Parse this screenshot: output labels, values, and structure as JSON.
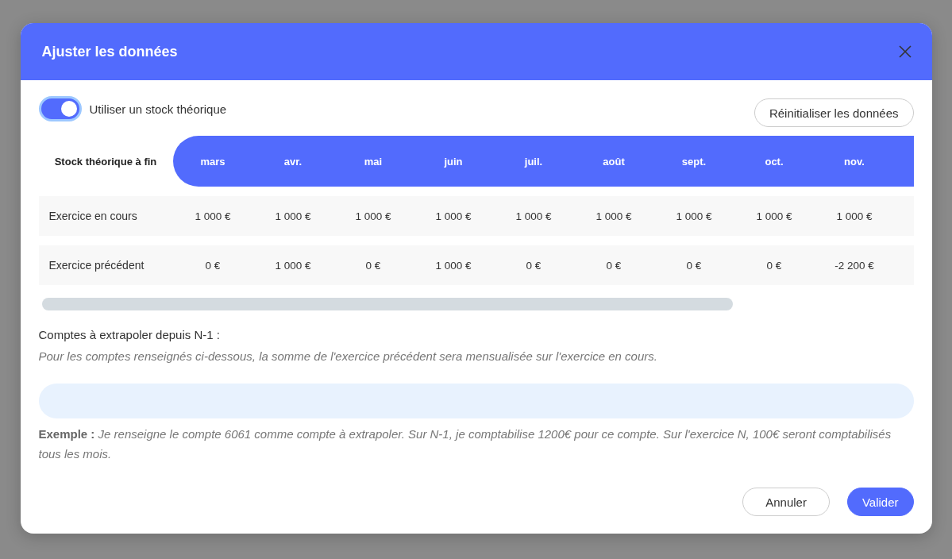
{
  "dialog": {
    "title": "Ajuster les données"
  },
  "toggle": {
    "label": "Utiliser un stock théorique",
    "on": true
  },
  "reset_button": "Réinitialiser les données",
  "table": {
    "corner": "Stock théorique à fin",
    "columns": [
      "mars",
      "avr.",
      "mai",
      "juin",
      "juil.",
      "août",
      "sept.",
      "oct.",
      "nov."
    ],
    "rows": [
      {
        "label": "Exercice en cours",
        "cells": [
          "1 000 €",
          "1 000 €",
          "1 000 €",
          "1 000 €",
          "1 000 €",
          "1 000 €",
          "1 000 €",
          "1 000 €",
          "1 000 €"
        ]
      },
      {
        "label": "Exercice précédent",
        "cells": [
          "0 €",
          "1 000 €",
          "0 €",
          "1 000 €",
          "0 €",
          "0 €",
          "0 €",
          "0 €",
          "-2 200 €"
        ]
      }
    ]
  },
  "accounts": {
    "title": "Comptes à extrapoler depuis N-1 :",
    "hint": "Pour les comptes renseignés ci-dessous, la somme de l'exercice précédent sera mensualisée sur l'exercice en cours.",
    "example": "**Exemple :** *Je renseigne le compte 6061 comme compte à extrapoler. Sur N-1, je comptabilise 1200€ pour ce compte. Sur l'exercice N, 100€ seront comptabilisés tous les mois.*"
  },
  "buttons": [
    {
      "label": "Annuler",
      "kind": "secondary"
    },
    {
      "label": "Valider",
      "kind": "primary"
    }
  ]
}
